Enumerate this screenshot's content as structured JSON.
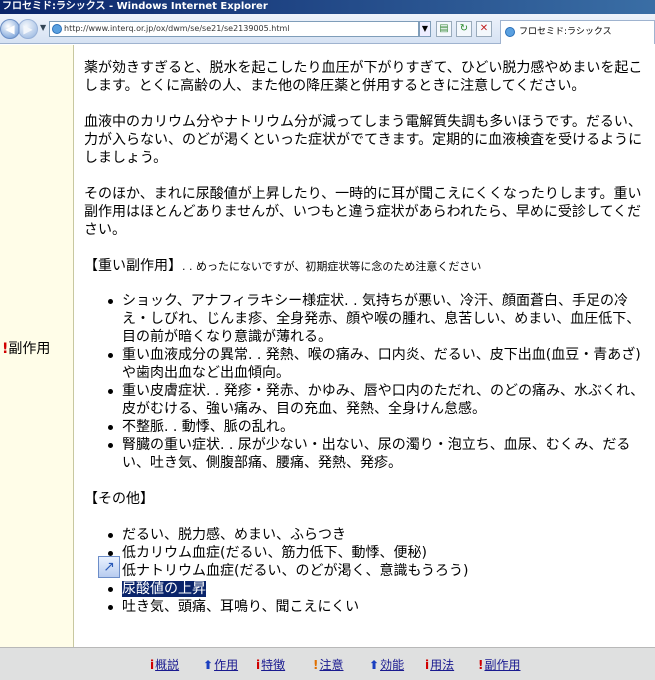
{
  "window": {
    "title": "フロセミド:ラシックス - Windows Internet Explorer"
  },
  "toolbar": {
    "address": "http://www.interq.or.jp/ox/dwm/se/se21/se2139005.html",
    "tab_title": "フロセミド:ラシックス",
    "icons": [
      "back-icon",
      "forward-icon",
      "page-icon",
      "refresh-icon",
      "stop-icon"
    ]
  },
  "section": {
    "label": "副作用",
    "marker": "!"
  },
  "paragraphs": [
    "薬が効きすぎると、脱水を起こしたり血圧が下がりすぎて、ひどい脱力感やめまいを起こします。とくに高齢の人、また他の降圧薬と併用するときに注意してください。",
    "血液中のカリウム分やナトリウム分が減ってしまう電解質失調も多いほうです。だるい、力が入らない、のどが渇くといった症状がでてきます。定期的に血液検査を受けるようにしましょう。",
    "そのほか、まれに尿酸値が上昇したり、一時的に耳が聞こえにくくなったりします。重い副作用はほとんどありませんが、いつもと違う症状があらわれたら、早めに受診してください。"
  ],
  "heavy": {
    "heading": "【重い副作用】",
    "note": ". . めったにないですが、初期症状等に念のため注意ください",
    "items": [
      "ショック、アナフィラキシー様症状. . 気持ちが悪い、冷汗、顔面蒼白、手足の冷え・しびれ、じんま疹、全身発赤、顔や喉の腫れ、息苦しい、めまい、血圧低下、目の前が暗くなり意識が薄れる。",
      "重い血液成分の異常. . 発熱、喉の痛み、口内炎、だるい、皮下出血(血豆・青あざ)や歯肉出血など出血傾向。",
      "重い皮膚症状. . 発疹・発赤、かゆみ、唇や口内のただれ、のどの痛み、水ぶくれ、皮がむける、強い痛み、目の充血、発熱、全身けん怠感。",
      "不整脈. . 動悸、脈の乱れ。",
      "腎臓の重い症状. . 尿が少ない・出ない、尿の濁り・泡立ち、血尿、むくみ、だるい、吐き気、側腹部痛、腰痛、発熱、発疹。"
    ]
  },
  "other": {
    "heading": "【その他】",
    "items": [
      "だるい、脱力感、めまい、ふらつき",
      "低カリウム血症(だるい、筋力低下、動悸、便秘)",
      "低ナトリウム血症(だるい、のどが渇く、意識もうろう)",
      "尿酸値の上昇",
      "吐き気、頭痛、耳鳴り、聞こえにくい"
    ],
    "selected_index": 3
  },
  "bottom_nav": [
    {
      "marker": "i",
      "label": "概説",
      "color": "#d00000"
    },
    {
      "marker": "⬆",
      "label": "作用",
      "color": "#1a3fc0"
    },
    {
      "marker": "i",
      "label": "特徴",
      "color": "#d00000"
    },
    {
      "marker": "!",
      "label": "注意",
      "color": "#e07000"
    },
    {
      "marker": "⬆",
      "label": "効能",
      "color": "#1a3fc0"
    },
    {
      "marker": "i",
      "label": "用法",
      "color": "#d00000"
    },
    {
      "marker": "!",
      "label": "副作用",
      "color": "#d00000"
    }
  ]
}
